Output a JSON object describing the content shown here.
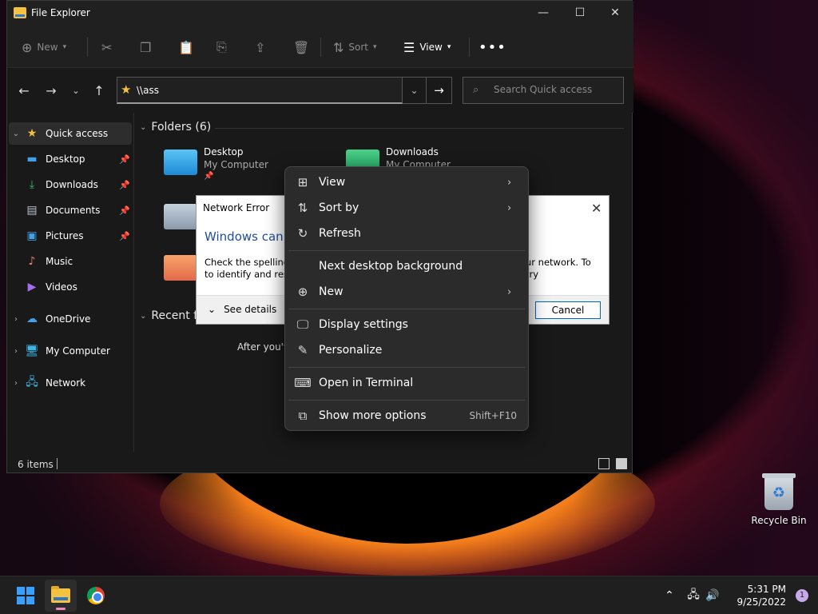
{
  "window": {
    "title": "File Explorer",
    "minimize": "—",
    "maximize": "☐",
    "close": "✕"
  },
  "toolbar": {
    "new_label": "New",
    "sort_label": "Sort",
    "view_label": "View",
    "more_label": "•••"
  },
  "address": {
    "value": "\\\\ass",
    "search_placeholder": "Search Quick access"
  },
  "sidebar": {
    "items": [
      {
        "label": "Quick access",
        "icon": "star-icon"
      },
      {
        "label": "Desktop",
        "icon": "desktop-icon"
      },
      {
        "label": "Downloads",
        "icon": "download-icon"
      },
      {
        "label": "Documents",
        "icon": "document-icon"
      },
      {
        "label": "Pictures",
        "icon": "picture-icon"
      },
      {
        "label": "Music",
        "icon": "music-icon"
      },
      {
        "label": "Videos",
        "icon": "video-icon"
      },
      {
        "label": "OneDrive",
        "icon": "cloud-icon"
      },
      {
        "label": "My Computer",
        "icon": "computer-icon"
      },
      {
        "label": "Network",
        "icon": "network-icon"
      }
    ]
  },
  "content": {
    "folders_header": "Folders (6)",
    "recent_header": "Recent fi",
    "recent_message": "After you've",
    "tiles": [
      {
        "name": "Desktop",
        "location": "My Computer"
      },
      {
        "name": "Downloads",
        "location": "My Computer"
      }
    ]
  },
  "status": {
    "item_count": "6 items"
  },
  "network_error": {
    "title": "Network Error",
    "heading": "Windows cann",
    "body_line1": "Check the spelling",
    "body_line2": "to identify and reso",
    "body_right": "ur network. To try",
    "details_label": "See details",
    "cancel_label": "Cancel"
  },
  "context_menu": {
    "items": [
      {
        "label": "View",
        "icon": "grid-icon"
      },
      {
        "label": "Sort by",
        "icon": "sort-icon"
      },
      {
        "label": "Refresh",
        "icon": "refresh-icon"
      },
      {
        "label": "Next desktop background"
      },
      {
        "label": "New",
        "icon": "plus-circle-icon"
      },
      {
        "label": "Display settings",
        "icon": "display-icon"
      },
      {
        "label": "Personalize",
        "icon": "brush-icon"
      },
      {
        "label": "Open in Terminal",
        "icon": "terminal-icon"
      },
      {
        "label": "Show more options",
        "icon": "expand-icon",
        "shortcut": "Shift+F10"
      }
    ]
  },
  "desktop": {
    "recycle_bin_label": "Recycle Bin"
  },
  "taskbar": {
    "time": "5:31 PM",
    "date": "9/25/2022",
    "notification_count": "1"
  },
  "colors": {
    "accent": "#0067c0",
    "folder_yellow": "#f5c141",
    "menu_bg": "#2b2b2b",
    "error_heading": "#1f4e9a"
  }
}
